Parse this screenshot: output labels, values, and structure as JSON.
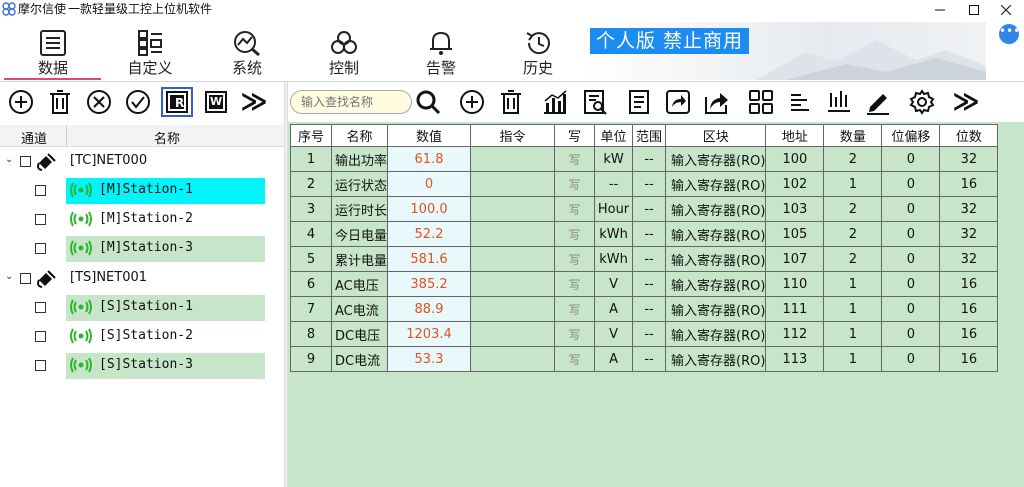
{
  "window": {
    "app_name": "摩尔信使",
    "subtitle": "一款轻量级工控上位机软件"
  },
  "nav": {
    "tabs": [
      {
        "label": "数据",
        "icon": "list-icon"
      },
      {
        "label": "自定义",
        "icon": "grid-icon"
      },
      {
        "label": "系统",
        "icon": "chart-search-icon"
      },
      {
        "label": "控制",
        "icon": "control-icon"
      },
      {
        "label": "告警",
        "icon": "bell-icon"
      },
      {
        "label": "历史",
        "icon": "history-icon"
      }
    ],
    "banner": "个人版  禁止商用",
    "more": "•••"
  },
  "left_toolbar": {
    "icons": [
      "add-icon",
      "delete-icon",
      "close-circle-icon",
      "check-circle-icon",
      "read-icon",
      "write-icon",
      "more-icon"
    ],
    "read_letter": "R",
    "write_letter": "W",
    "more_glyph": "≫"
  },
  "tree": {
    "col_channel": "通道",
    "col_name": "名称",
    "groups": [
      {
        "label": "[TC]NET000",
        "stations": [
          "[M]Station-1",
          "[M]Station-2",
          "[M]Station-3"
        ]
      },
      {
        "label": "[TS]NET001",
        "stations": [
          "[S]Station-1",
          "[S]Station-2",
          "[S]Station-3"
        ]
      }
    ]
  },
  "right_toolbar": {
    "search_placeholder": "输入查找名称",
    "icons": [
      "search-icon",
      "add-icon",
      "delete-icon",
      "bar-chart-icon",
      "report-search-icon",
      "document-icon",
      "import-icon",
      "export-icon",
      "grid-view-icon",
      "align-icon",
      "vertical-bars-icon",
      "signature-icon",
      "settings-icon",
      "more-icon"
    ]
  },
  "table": {
    "headers": [
      "序号",
      "名称",
      "数值",
      "指令",
      "写",
      "单位",
      "范围",
      "区块",
      "地址",
      "数量",
      "位偏移",
      "位数"
    ],
    "rows": [
      {
        "idx": "1",
        "name": "输出功率",
        "value": "61.8",
        "cmd": "",
        "write": "写",
        "unit": "kW",
        "range": "--",
        "area": "输入寄存器(RO)",
        "addr": "100",
        "count": "2",
        "bitoff": "0",
        "bits": "32"
      },
      {
        "idx": "2",
        "name": "运行状态",
        "value": "0",
        "cmd": "",
        "write": "写",
        "unit": "--",
        "range": "--",
        "area": "输入寄存器(RO)",
        "addr": "102",
        "count": "1",
        "bitoff": "0",
        "bits": "16"
      },
      {
        "idx": "3",
        "name": "运行时长",
        "value": "100.0",
        "cmd": "",
        "write": "写",
        "unit": "Hour",
        "range": "--",
        "area": "输入寄存器(RO)",
        "addr": "103",
        "count": "2",
        "bitoff": "0",
        "bits": "32"
      },
      {
        "idx": "4",
        "name": "今日电量",
        "value": "52.2",
        "cmd": "",
        "write": "写",
        "unit": "kWh",
        "range": "--",
        "area": "输入寄存器(RO)",
        "addr": "105",
        "count": "2",
        "bitoff": "0",
        "bits": "32"
      },
      {
        "idx": "5",
        "name": "累计电量",
        "value": "581.6",
        "cmd": "",
        "write": "写",
        "unit": "kWh",
        "range": "--",
        "area": "输入寄存器(RO)",
        "addr": "107",
        "count": "2",
        "bitoff": "0",
        "bits": "32"
      },
      {
        "idx": "6",
        "name": "AC电压",
        "value": "385.2",
        "cmd": "",
        "write": "写",
        "unit": "V",
        "range": "--",
        "area": "输入寄存器(RO)",
        "addr": "110",
        "count": "1",
        "bitoff": "0",
        "bits": "16"
      },
      {
        "idx": "7",
        "name": "AC电流",
        "value": "88.9",
        "cmd": "",
        "write": "写",
        "unit": "A",
        "range": "--",
        "area": "输入寄存器(RO)",
        "addr": "111",
        "count": "1",
        "bitoff": "0",
        "bits": "16"
      },
      {
        "idx": "8",
        "name": "DC电压",
        "value": "1203.4",
        "cmd": "",
        "write": "写",
        "unit": "V",
        "range": "--",
        "area": "输入寄存器(RO)",
        "addr": "112",
        "count": "1",
        "bitoff": "0",
        "bits": "16"
      },
      {
        "idx": "9",
        "name": "DC电流",
        "value": "53.3",
        "cmd": "",
        "write": "写",
        "unit": "A",
        "range": "--",
        "area": "输入寄存器(RO)",
        "addr": "113",
        "count": "1",
        "bitoff": "0",
        "bits": "16"
      }
    ]
  },
  "colors": {
    "accent_blue": "#1d8cf0",
    "row_green": "#c7e6c9",
    "selected_cyan": "#00f5fa",
    "value_orange": "#e0521e",
    "tab_underline": "#e0496d"
  }
}
